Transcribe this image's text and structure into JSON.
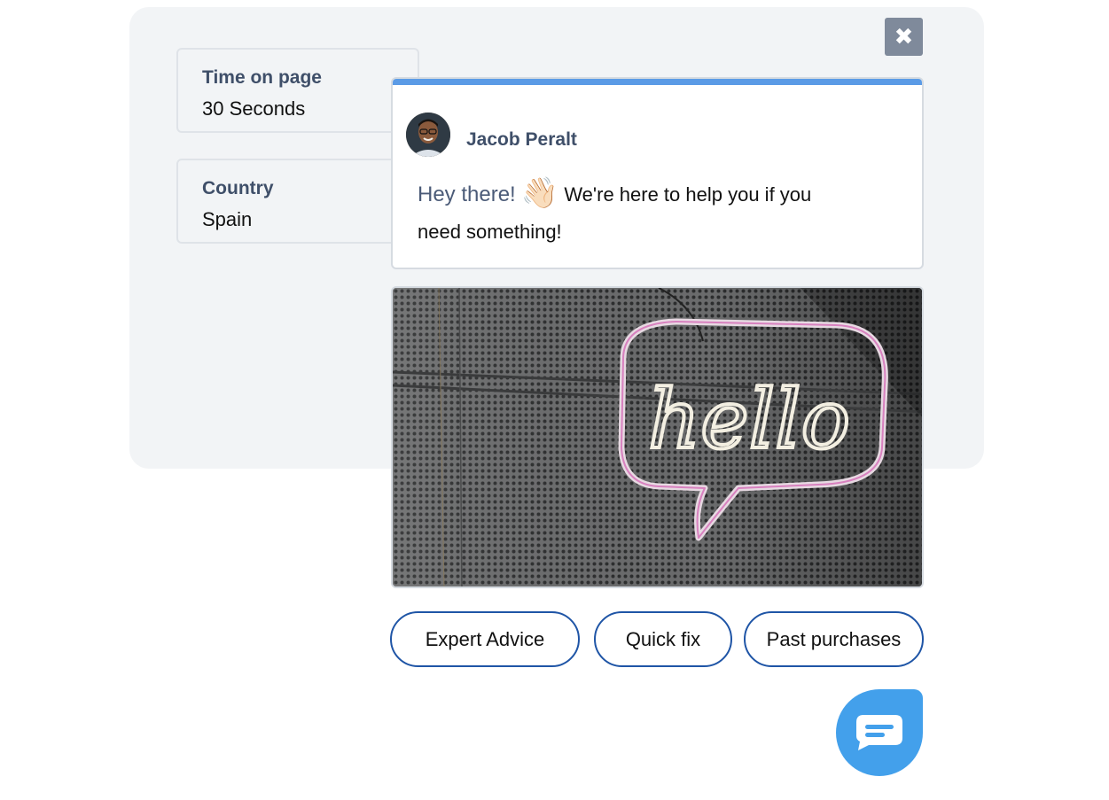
{
  "close": {
    "icon": "close-icon",
    "glyph": "✖"
  },
  "info_cards": [
    {
      "label": "Time on page",
      "value": "30 Seconds"
    },
    {
      "label": "Country",
      "value": "Spain"
    }
  ],
  "message": {
    "agent_name": "Jacob Peralt",
    "greeting": "Hey there!",
    "wave_emoji": "👋🏻",
    "body": "We're here to help you if you need something!"
  },
  "image": {
    "sign_text": "hello"
  },
  "chips": [
    {
      "label": "Expert Advice"
    },
    {
      "label": "Quick fix"
    },
    {
      "label": "Past purchases"
    }
  ],
  "launcher": {
    "icon": "chat-bubble-icon"
  },
  "colors": {
    "accent": "#5b9be6",
    "launcher": "#43a0eb",
    "chip_border": "#1f55a6",
    "label_text": "#3f4f69"
  }
}
